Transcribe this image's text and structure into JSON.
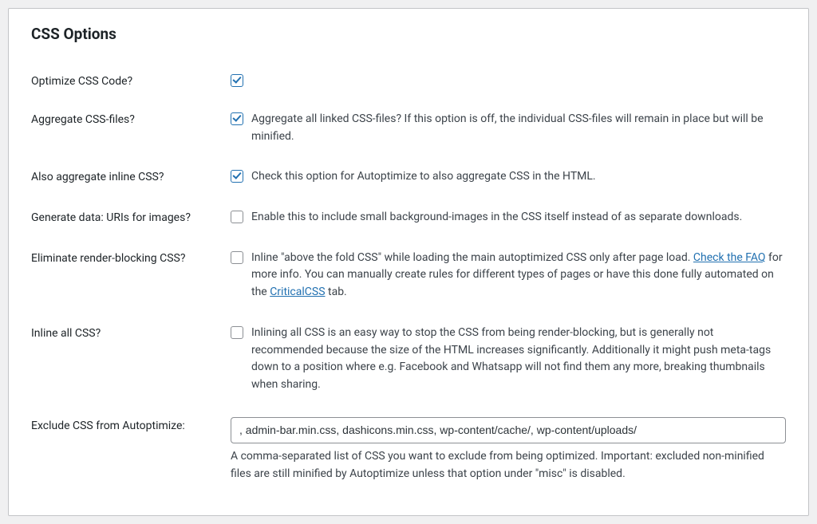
{
  "section": {
    "title": "CSS Options"
  },
  "rows": {
    "optimize": {
      "label": "Optimize CSS Code?",
      "checked": true
    },
    "aggregate": {
      "label": "Aggregate CSS-files?",
      "checked": true,
      "desc": "Aggregate all linked CSS-files? If this option is off, the individual CSS-files will remain in place but will be minified."
    },
    "inlineagg": {
      "label": "Also aggregate inline CSS?",
      "checked": true,
      "desc": "Check this option for Autoptimize to also aggregate CSS in the HTML."
    },
    "datauris": {
      "label": "Generate data: URIs for images?",
      "checked": false,
      "desc": "Enable this to include small background-images in the CSS itself instead of as separate downloads."
    },
    "renderblk": {
      "label": "Eliminate render-blocking CSS?",
      "checked": false,
      "part1": "Inline \"above the fold CSS\" while loading the main autoptimized CSS only after page load. ",
      "link1": "Check the FAQ",
      "part2": " for more info. You can manually create rules for different types of pages or have this done fully automated on the ",
      "link2": "CriticalCSS",
      "part3": " tab."
    },
    "inlineall": {
      "label": "Inline all CSS?",
      "checked": false,
      "desc": "Inlining all CSS is an easy way to stop the CSS from being render-blocking, but is generally not recommended because the size of the HTML increases significantly. Additionally it might push meta-tags down to a position where e.g. Facebook and Whatsapp will not find them any more, breaking thumbnails when sharing."
    },
    "exclude": {
      "label": "Exclude CSS from Autoptimize:",
      "value": ", admin-bar.min.css, dashicons.min.css, wp-content/cache/, wp-content/uploads/",
      "help": "A comma-separated list of CSS you want to exclude from being optimized. Important: excluded non-minified files are still minified by Autoptimize unless that option under \"misc\" is disabled."
    }
  }
}
